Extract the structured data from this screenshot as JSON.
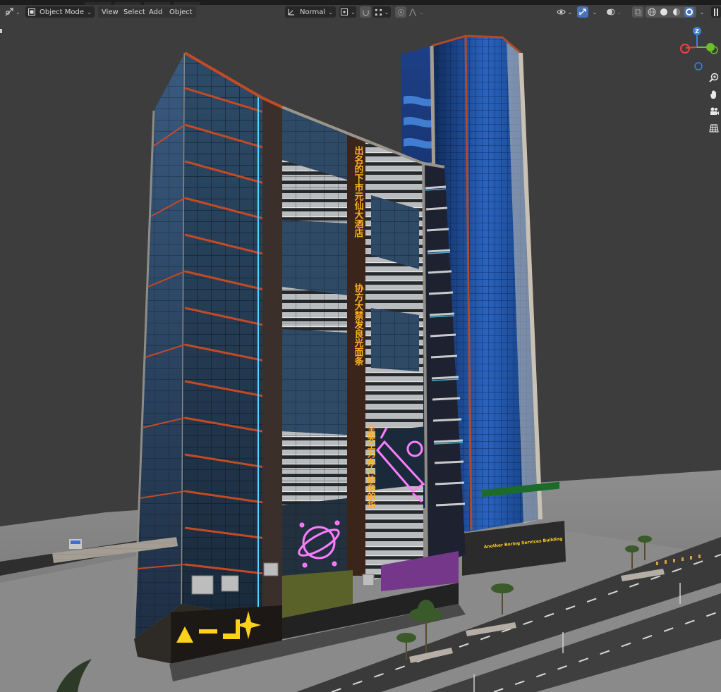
{
  "header": {
    "editor_type_icon": "3d-viewport-icon",
    "mode": {
      "label": "Object Mode",
      "icon": "object-mode-icon"
    },
    "menus": [
      "View",
      "Select",
      "Add",
      "Object"
    ],
    "orientation": {
      "label": "Normal",
      "icon": "transform-orientation-icon"
    },
    "icons_center": [
      "pivot-point-icon",
      "snap-icon",
      "snap-target-icon",
      "proportional-editing-icon",
      "falloff-icon"
    ],
    "icons_right": [
      "visibility-icon",
      "gizmo-icon",
      "overlay-icon",
      "xray-icon",
      "wireframe-shading-icon",
      "solid-shading-icon",
      "material-shading-icon",
      "rendered-shading-icon",
      "shading-options-icon",
      "sidebar-toggle-icon"
    ]
  },
  "gizmo": {
    "axis_up": "Z",
    "colors": {
      "x": "#e84545",
      "y": "#6bbf2a",
      "z": "#3c82d8"
    }
  },
  "nav_tools": [
    "zoom-icon",
    "pan-hand-icon",
    "camera-view-icon",
    "grid-view-icon"
  ],
  "scene": {
    "signage": {
      "vertical_banner_1": "出名的下市元仙大酒店",
      "vertical_banner_2": "协方大禁发良光面条",
      "vertical_banner_3": "全美生力办大协奈的华",
      "store_sign": "Another Boring Services Building"
    },
    "colors": {
      "background": "#3d3d3d",
      "glass": "#1f3650",
      "tower_glass": "#1c4f9a",
      "frame": "#b04a2a",
      "neon_pink": "#ff7cff",
      "neon_yellow": "#ffd21a",
      "accent": "#4772b3"
    }
  }
}
